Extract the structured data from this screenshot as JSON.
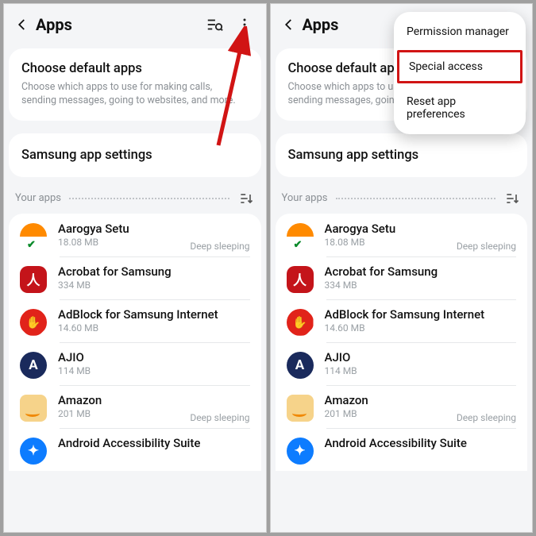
{
  "header": {
    "title": "Apps"
  },
  "default_card": {
    "title": "Choose default apps",
    "desc": "Choose which apps to use for making calls, sending messages, going to websites, and more."
  },
  "samsung_card": {
    "title": "Samsung app settings"
  },
  "your_apps_label": "Your apps",
  "menu": {
    "permission": "Permission manager",
    "special": "Special access",
    "reset": "Reset app preferences"
  },
  "apps": [
    {
      "name": "Aarogya Setu",
      "size": "18.08 MB",
      "status": "Deep sleeping",
      "icon": "aarogya",
      "glyph": ""
    },
    {
      "name": "Acrobat for Samsung",
      "size": "334 MB",
      "status": "",
      "icon": "acrobat",
      "glyph": "人"
    },
    {
      "name": "AdBlock for Samsung Internet",
      "size": "14.60 MB",
      "status": "",
      "icon": "adblock",
      "glyph": "✋"
    },
    {
      "name": "AJIO",
      "size": "114 MB",
      "status": "",
      "icon": "ajio",
      "glyph": "A"
    },
    {
      "name": "Amazon",
      "size": "201 MB",
      "status": "Deep sleeping",
      "icon": "amazon",
      "glyph": ""
    },
    {
      "name": "Android Accessibility Suite",
      "size": "",
      "status": "",
      "icon": "access",
      "glyph": "✦"
    }
  ]
}
